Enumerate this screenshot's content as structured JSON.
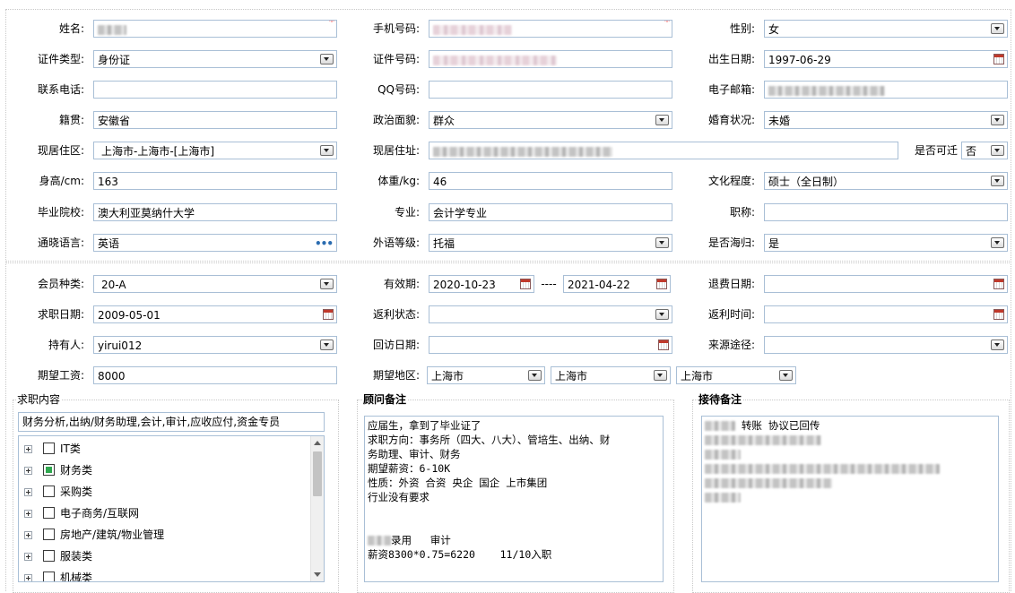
{
  "colors": {
    "accent_border": "#a9bfd6",
    "required": "#e00000",
    "checked": "#2fa84f"
  },
  "labels": {
    "name": "姓名:",
    "mobile": "手机号码:",
    "gender": "性别:",
    "id_type": "证件类型:",
    "id_number": "证件号码:",
    "birth_date": "出生日期:",
    "phone": "联系电话:",
    "qq": "QQ号码:",
    "email": "电子邮箱:",
    "native_place": "籍贯:",
    "political": "政治面貌:",
    "marital": "婚育状况:",
    "residence_area": "现居住区:",
    "residence_address": "现居住址:",
    "relocate": "是否可迁",
    "height": "身高/cm:",
    "weight": "体重/kg:",
    "education": "文化程度:",
    "school": "毕业院校:",
    "major": "专业:",
    "title": "职称:",
    "languages": "通晓语言:",
    "lang_level": "外语等级:",
    "returnee": "是否海归:",
    "member_type": "会员种类:",
    "valid_period": "有效期:",
    "valid_sep": "----",
    "refund_date": "退费日期:",
    "job_date": "求职日期:",
    "rebate_status": "返利状态:",
    "rebate_time": "返利时间:",
    "holder": "持有人:",
    "revisit_date": "回访日期:",
    "source": "来源途径:",
    "expected_salary": "期望工资:",
    "expected_region": "期望地区:"
  },
  "values": {
    "name": "",
    "mobile": "",
    "gender": "女",
    "id_type": "身份证",
    "id_number": "",
    "birth_date": "1997-06-29",
    "phone": "",
    "qq": "",
    "email": "",
    "native_place": "安徽省",
    "political": "群众",
    "marital": "未婚",
    "residence_area": "上海市-上海市-[上海市]",
    "residence_address": "",
    "relocate": "否",
    "height": "163",
    "weight": "46",
    "education": "硕士（全日制）",
    "school": "澳大利亚莫纳什大学",
    "major": "会计学专业",
    "title": "",
    "languages": "英语",
    "languages_more": "•••",
    "lang_level": "托福",
    "returnee": "是",
    "member_type": "20-A",
    "valid_from": "2020-10-23",
    "valid_to": "2021-04-22",
    "refund_date": "",
    "job_date": "2009-05-01",
    "rebate_status": "",
    "rebate_time": "",
    "holder": "yirui012",
    "revisit_date": "",
    "source": "",
    "expected_salary": "8000",
    "region_1": "上海市",
    "region_2": "上海市",
    "region_3": "上海市"
  },
  "job_content": {
    "title": "求职内容",
    "summary": "财务分析,出纳/财务助理,会计,审计,应收应付,资金专员",
    "tree": [
      {
        "label": "IT类",
        "checked": false
      },
      {
        "label": "财务类",
        "checked": true
      },
      {
        "label": "采购类",
        "checked": false
      },
      {
        "label": "电子商务/互联网",
        "checked": false
      },
      {
        "label": "房地产/建筑/物业管理",
        "checked": false
      },
      {
        "label": "服装类",
        "checked": false
      },
      {
        "label": "机械类",
        "checked": false
      }
    ]
  },
  "consultant_notes": {
    "title": "顾问备注",
    "line1": "应届生，拿到了毕业证了",
    "line2": "求职方向：事务所（四大、八大）、管培生、出纳、财",
    "line3": "务助理、审计、财务",
    "line4": "期望薪资：6-10K",
    "line5": "性质：外资 合资 央企 国企 上市集团",
    "line6": "行业没有要求",
    "line7_suffix": "录用   审计",
    "line8": "薪资8300*0.75=6220    11/10入职"
  },
  "reception_notes": {
    "title": "接待备注",
    "line1_suffix": " 转账 协议已回传"
  }
}
